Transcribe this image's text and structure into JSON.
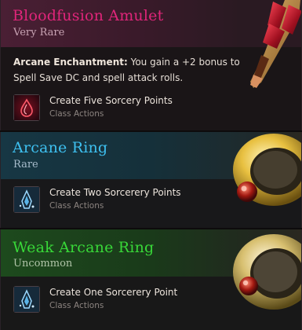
{
  "items": [
    {
      "title": "Bloodfusion Amulet",
      "rarity": "Very Rare",
      "enchantment_name": "Arcane Enchantment:",
      "enchantment_text": " You gain a +2 bonus to Spell Save DC and spell attack rolls.",
      "action": {
        "name": "Create Five Sorcery Points",
        "category": "Class Actions",
        "icon": "blood-drop-icon"
      },
      "title_color": "#e0257a"
    },
    {
      "title": "Arcane Ring",
      "rarity": "Rare",
      "action": {
        "name": "Create Two Sorcerery Points",
        "category": "Class Actions",
        "icon": "arcane-flame-icon"
      },
      "title_color": "#3ec0f0"
    },
    {
      "title": "Weak Arcane Ring",
      "rarity": "Uncommon",
      "action": {
        "name": "Create One Sorcerery Point",
        "category": "Class Actions",
        "icon": "arcane-flame-icon"
      },
      "title_color": "#38d838"
    }
  ]
}
